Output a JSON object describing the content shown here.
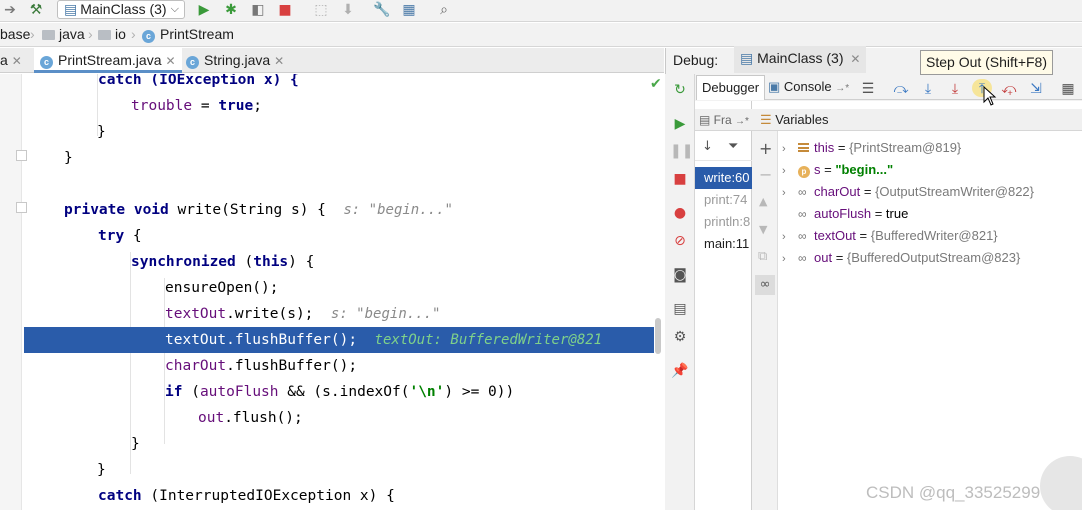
{
  "toolbar": {
    "run_config": "MainClass (3)",
    "icons": [
      "hammer-icon",
      "run-icon",
      "debug-icon",
      "coverage-icon",
      "stop-icon",
      "wrench-icon",
      "project-structure-icon",
      "search-icon"
    ]
  },
  "breadcrumb": [
    "base",
    "java",
    "io",
    "PrintStream"
  ],
  "editor_tabs": [
    {
      "label": "a",
      "active": false
    },
    {
      "label": "PrintStream.java",
      "active": true
    },
    {
      "label": "String.java",
      "active": false
    }
  ],
  "code": {
    "l1": "catch (IOException x) {",
    "l2_field": "trouble",
    "l2_rest": " = ",
    "l2_kw": "true",
    "l2_end": ";",
    "brace": "}",
    "l6_kw1": "private",
    "l6_kw2": "void",
    "l6_sig": " write(String s) {",
    "l6_inlay": "s: \"begin...\"",
    "l7_kw": "try",
    "l7_rest": " {",
    "l8_kw": "synchronized",
    "l8_paren": " (",
    "l8_this": "this",
    "l8_rest": ") {",
    "l9": "ensureOpen();",
    "l10_field": "textOut",
    "l10_rest": ".write(s);",
    "l10_inlay": "s: \"begin...\"",
    "l11_field": "textOut",
    "l11_rest": ".flushBuffer();",
    "l11_inlay": "textOut: BufferedWriter@821",
    "l12_field": "charOut",
    "l12_rest": ".flushBuffer();",
    "l13_kw": "if",
    "l13_paren": " (",
    "l13_field": "autoFlush",
    "l13_rest": " && (s.indexOf(",
    "l13_str": "'\\n'",
    "l13_end": ") >= 0))",
    "l14_field": "out",
    "l14_rest": ".flush();",
    "l17_kw": "catch",
    "l17_rest": " (InterruptedIOException x) {"
  },
  "debug": {
    "label": "Debug:",
    "session": "MainClass (3)",
    "tabs": {
      "debugger": "Debugger",
      "console": "Console",
      "console_arrow": "→*"
    },
    "tooltip": "Step Out (Shift+F8)",
    "frames_header": "Fra",
    "frames_header_arrow": "→*",
    "variables_header": "Variables",
    "frames": [
      {
        "label": "write:60",
        "state": "active"
      },
      {
        "label": "print:74",
        "state": "dim"
      },
      {
        "label": "println:8",
        "state": "dim"
      },
      {
        "label": "main:11",
        "state": "normal"
      }
    ],
    "variables": [
      {
        "name": "this",
        "eq": " = ",
        "value": "{PrintStream@819}",
        "expandable": true,
        "icon": "field-icon"
      },
      {
        "name": "s",
        "eq": " = ",
        "value": "\"begin...\"",
        "expandable": true,
        "icon": "param-icon"
      },
      {
        "name": "charOut",
        "eq": " = ",
        "value": "{OutputStreamWriter@822}",
        "expandable": true,
        "icon": "infinity-icon"
      },
      {
        "name": "autoFlush",
        "eq": " = ",
        "value": "true",
        "expandable": false,
        "icon": "infinity-icon"
      },
      {
        "name": "textOut",
        "eq": " = ",
        "value": "{BufferedWriter@821}",
        "expandable": true,
        "icon": "infinity-icon"
      },
      {
        "name": "out",
        "eq": " = ",
        "value": "{BufferedOutputStream@823}",
        "expandable": true,
        "icon": "infinity-icon"
      }
    ]
  },
  "watermark": "CSDN @qq_33525299",
  "colors": {
    "selection": "#2a5caa",
    "keyword": "#000080",
    "field": "#660e7a",
    "string": "#008000",
    "inlay": "#8a8a8a"
  }
}
